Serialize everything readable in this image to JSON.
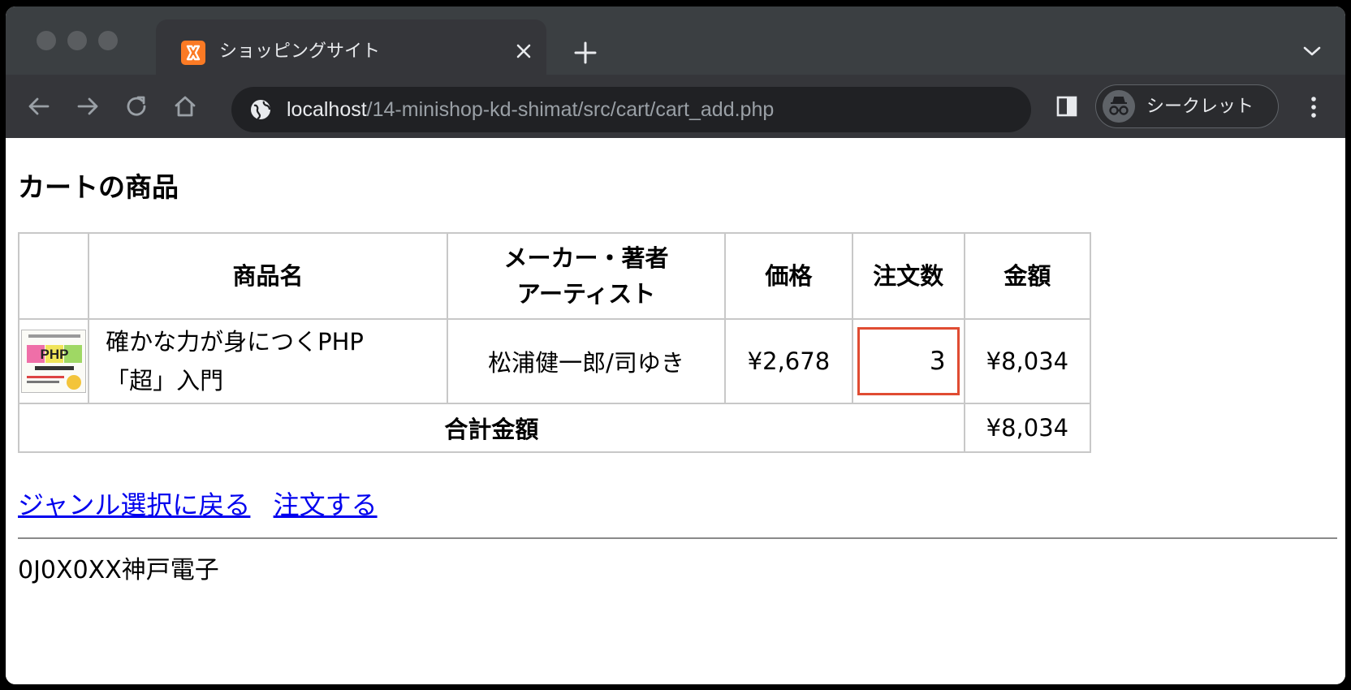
{
  "browser": {
    "tab_title": "ショッピングサイト",
    "url_host": "localhost",
    "url_path": "/14-minishop-kd-shimat/src/cart/cart_add.php",
    "incognito_label": "シークレット"
  },
  "page": {
    "heading": "カートの商品",
    "table": {
      "headers": {
        "image": "",
        "name": "商品名",
        "maker_line1": "メーカー・著者",
        "maker_line2": "アーティスト",
        "price": "価格",
        "quantity": "注文数",
        "amount": "金額"
      },
      "items": [
        {
          "name_line1": "確かな力が身につくPHP",
          "name_line2": "「超」入門",
          "maker": "松浦健一郎/司ゆき",
          "price": "¥2,678",
          "quantity": "3",
          "amount": "¥8,034",
          "thumbnail_text": "PHP"
        }
      ],
      "total_label": "合計金額",
      "total_amount": "¥8,034"
    },
    "links": {
      "back": "ジャンル選択に戻る",
      "order": "注文する"
    },
    "footer": "0J0X0XX神戸電子"
  },
  "colors": {
    "tabstrip_bg": "#3b3f42",
    "toolbar_bg": "#35363a",
    "omnibox_bg": "#202124",
    "favicon_orange": "#fb7a24",
    "qty_border": "#e04c32",
    "link": "#0000ee"
  }
}
